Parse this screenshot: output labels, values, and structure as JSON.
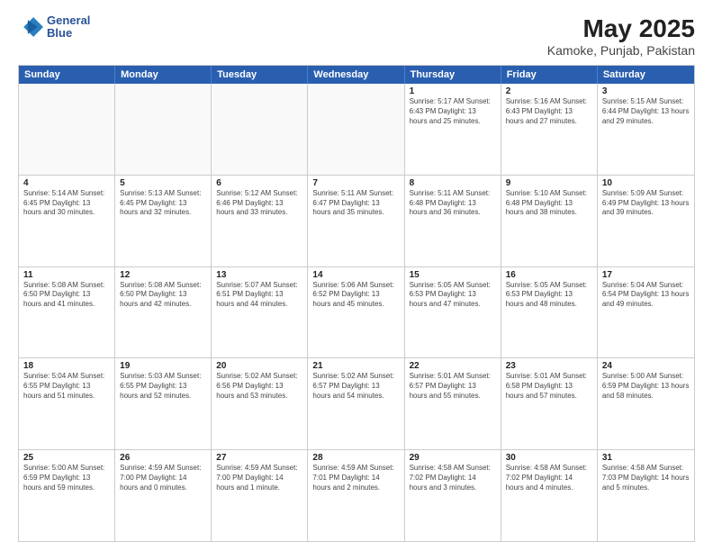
{
  "header": {
    "logo_line1": "General",
    "logo_line2": "Blue",
    "month": "May 2025",
    "location": "Kamoke, Punjab, Pakistan"
  },
  "days_of_week": [
    "Sunday",
    "Monday",
    "Tuesday",
    "Wednesday",
    "Thursday",
    "Friday",
    "Saturday"
  ],
  "weeks": [
    [
      {
        "day": "",
        "info": ""
      },
      {
        "day": "",
        "info": ""
      },
      {
        "day": "",
        "info": ""
      },
      {
        "day": "",
        "info": ""
      },
      {
        "day": "1",
        "info": "Sunrise: 5:17 AM\nSunset: 6:43 PM\nDaylight: 13 hours\nand 25 minutes."
      },
      {
        "day": "2",
        "info": "Sunrise: 5:16 AM\nSunset: 6:43 PM\nDaylight: 13 hours\nand 27 minutes."
      },
      {
        "day": "3",
        "info": "Sunrise: 5:15 AM\nSunset: 6:44 PM\nDaylight: 13 hours\nand 29 minutes."
      }
    ],
    [
      {
        "day": "4",
        "info": "Sunrise: 5:14 AM\nSunset: 6:45 PM\nDaylight: 13 hours\nand 30 minutes."
      },
      {
        "day": "5",
        "info": "Sunrise: 5:13 AM\nSunset: 6:45 PM\nDaylight: 13 hours\nand 32 minutes."
      },
      {
        "day": "6",
        "info": "Sunrise: 5:12 AM\nSunset: 6:46 PM\nDaylight: 13 hours\nand 33 minutes."
      },
      {
        "day": "7",
        "info": "Sunrise: 5:11 AM\nSunset: 6:47 PM\nDaylight: 13 hours\nand 35 minutes."
      },
      {
        "day": "8",
        "info": "Sunrise: 5:11 AM\nSunset: 6:48 PM\nDaylight: 13 hours\nand 36 minutes."
      },
      {
        "day": "9",
        "info": "Sunrise: 5:10 AM\nSunset: 6:48 PM\nDaylight: 13 hours\nand 38 minutes."
      },
      {
        "day": "10",
        "info": "Sunrise: 5:09 AM\nSunset: 6:49 PM\nDaylight: 13 hours\nand 39 minutes."
      }
    ],
    [
      {
        "day": "11",
        "info": "Sunrise: 5:08 AM\nSunset: 6:50 PM\nDaylight: 13 hours\nand 41 minutes."
      },
      {
        "day": "12",
        "info": "Sunrise: 5:08 AM\nSunset: 6:50 PM\nDaylight: 13 hours\nand 42 minutes."
      },
      {
        "day": "13",
        "info": "Sunrise: 5:07 AM\nSunset: 6:51 PM\nDaylight: 13 hours\nand 44 minutes."
      },
      {
        "day": "14",
        "info": "Sunrise: 5:06 AM\nSunset: 6:52 PM\nDaylight: 13 hours\nand 45 minutes."
      },
      {
        "day": "15",
        "info": "Sunrise: 5:05 AM\nSunset: 6:53 PM\nDaylight: 13 hours\nand 47 minutes."
      },
      {
        "day": "16",
        "info": "Sunrise: 5:05 AM\nSunset: 6:53 PM\nDaylight: 13 hours\nand 48 minutes."
      },
      {
        "day": "17",
        "info": "Sunrise: 5:04 AM\nSunset: 6:54 PM\nDaylight: 13 hours\nand 49 minutes."
      }
    ],
    [
      {
        "day": "18",
        "info": "Sunrise: 5:04 AM\nSunset: 6:55 PM\nDaylight: 13 hours\nand 51 minutes."
      },
      {
        "day": "19",
        "info": "Sunrise: 5:03 AM\nSunset: 6:55 PM\nDaylight: 13 hours\nand 52 minutes."
      },
      {
        "day": "20",
        "info": "Sunrise: 5:02 AM\nSunset: 6:56 PM\nDaylight: 13 hours\nand 53 minutes."
      },
      {
        "day": "21",
        "info": "Sunrise: 5:02 AM\nSunset: 6:57 PM\nDaylight: 13 hours\nand 54 minutes."
      },
      {
        "day": "22",
        "info": "Sunrise: 5:01 AM\nSunset: 6:57 PM\nDaylight: 13 hours\nand 55 minutes."
      },
      {
        "day": "23",
        "info": "Sunrise: 5:01 AM\nSunset: 6:58 PM\nDaylight: 13 hours\nand 57 minutes."
      },
      {
        "day": "24",
        "info": "Sunrise: 5:00 AM\nSunset: 6:59 PM\nDaylight: 13 hours\nand 58 minutes."
      }
    ],
    [
      {
        "day": "25",
        "info": "Sunrise: 5:00 AM\nSunset: 6:59 PM\nDaylight: 13 hours\nand 59 minutes."
      },
      {
        "day": "26",
        "info": "Sunrise: 4:59 AM\nSunset: 7:00 PM\nDaylight: 14 hours\nand 0 minutes."
      },
      {
        "day": "27",
        "info": "Sunrise: 4:59 AM\nSunset: 7:00 PM\nDaylight: 14 hours\nand 1 minute."
      },
      {
        "day": "28",
        "info": "Sunrise: 4:59 AM\nSunset: 7:01 PM\nDaylight: 14 hours\nand 2 minutes."
      },
      {
        "day": "29",
        "info": "Sunrise: 4:58 AM\nSunset: 7:02 PM\nDaylight: 14 hours\nand 3 minutes."
      },
      {
        "day": "30",
        "info": "Sunrise: 4:58 AM\nSunset: 7:02 PM\nDaylight: 14 hours\nand 4 minutes."
      },
      {
        "day": "31",
        "info": "Sunrise: 4:58 AM\nSunset: 7:03 PM\nDaylight: 14 hours\nand 5 minutes."
      }
    ]
  ]
}
